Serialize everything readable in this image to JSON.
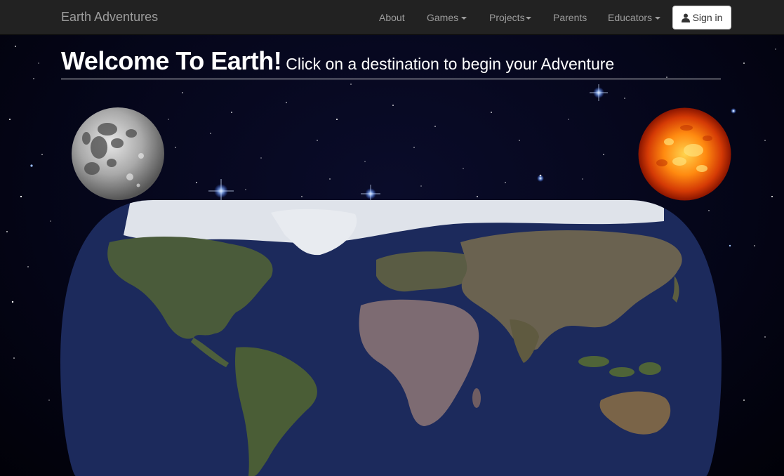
{
  "navbar": {
    "brand": "Earth Adventures",
    "items": [
      {
        "label": "About"
      },
      {
        "label": "Games"
      },
      {
        "label": "Projects"
      },
      {
        "label": "Parents"
      },
      {
        "label": "Educators"
      }
    ],
    "signin_label": "Sign in"
  },
  "hero": {
    "title": "Welcome To Earth!",
    "subtitle": "Click on a destination to begin your Adventure"
  },
  "colors": {
    "navbar_bg": "#222222",
    "navbar_text": "#9d9d9d",
    "ocean": "#1c2a5c",
    "space": "#05061a"
  },
  "icons": {
    "signin": "user-icon",
    "dropdown": "caret-down-icon"
  }
}
